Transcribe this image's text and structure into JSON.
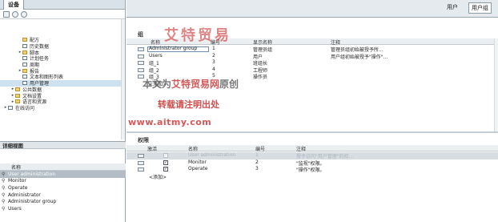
{
  "left": {
    "tab_label": "设备",
    "tree": [
      {
        "label": "配方",
        "indent": 2,
        "arrow": "",
        "icon": "folder"
      },
      {
        "label": "历史数据",
        "indent": 2,
        "arrow": "",
        "icon": "item"
      },
      {
        "label": "脚本",
        "indent": 2,
        "arrow": "▸",
        "icon": "folder"
      },
      {
        "label": "计划任务",
        "indent": 2,
        "arrow": "",
        "icon": "item"
      },
      {
        "label": "周期",
        "indent": 2,
        "arrow": "",
        "icon": "item"
      },
      {
        "label": "报告",
        "indent": 2,
        "arrow": "▸",
        "icon": "folder"
      },
      {
        "label": "文本和图形列表",
        "indent": 2,
        "arrow": "",
        "icon": "item"
      },
      {
        "label": "用户管理",
        "indent": 2,
        "arrow": "",
        "icon": "item",
        "selected": true
      },
      {
        "label": "公共数据",
        "indent": 1,
        "arrow": "▸",
        "icon": "folder"
      },
      {
        "label": "文档设置",
        "indent": 1,
        "arrow": "▸",
        "icon": "folder"
      },
      {
        "label": "语言和资源",
        "indent": 1,
        "arrow": "▸",
        "icon": "folder"
      },
      {
        "label": "在线访问",
        "indent": 0,
        "arrow": "▸",
        "icon": "item"
      }
    ],
    "detail_title": "详细视图",
    "detail_col": "名称",
    "detail_items": [
      {
        "label": "User administration",
        "selected": true
      },
      {
        "label": "Monitor"
      },
      {
        "label": "Operate"
      },
      {
        "label": "Administrator"
      },
      {
        "label": "Administrator group"
      },
      {
        "label": "Users"
      }
    ]
  },
  "right": {
    "tabs": [
      "用户",
      "用户组"
    ],
    "group_title": "组",
    "group_headers": {
      "name": "名称",
      "number": "编号",
      "display_name": "显示名称",
      "comment": "注释"
    },
    "groups": [
      {
        "name": "Administrator group",
        "number": "1",
        "display": "管理员组",
        "comment": "管理员组初始被授予所..."
      },
      {
        "name": "Users",
        "number": "2",
        "display": "用户",
        "comment": "用户组初始被授予\"操作\"..."
      },
      {
        "name": "组_1",
        "number": "3",
        "display": "班组长",
        "comment": ""
      },
      {
        "name": "组_2",
        "number": "4",
        "display": "工程师",
        "comment": ""
      },
      {
        "name": "组_3",
        "number": "5",
        "display": "操作员",
        "comment": ""
      }
    ],
    "add_label": "<添加>",
    "perm_title": "权限",
    "perm_headers": {
      "auth": "激活",
      "name": "名称",
      "number": "编号",
      "comment": "注释"
    },
    "permissions": [
      {
        "checked": true,
        "grey": true,
        "name": "User administration",
        "number": "1",
        "comment": "授予访问\"用户管理\"的权..."
      },
      {
        "checked": true,
        "grey": false,
        "name": "Monitor",
        "number": "2",
        "comment": "\"监视\"权限。"
      },
      {
        "checked": true,
        "grey": false,
        "name": "Operate",
        "number": "3",
        "comment": "\"操作\"权限。"
      }
    ]
  },
  "watermark": {
    "logo": "艾特贸易",
    "line1_a": "本文为",
    "line1_b": "艾特贸易网",
    "line1_c": "原创",
    "line2": "转载请注明出处",
    "line3": "www.aitmy.com"
  }
}
